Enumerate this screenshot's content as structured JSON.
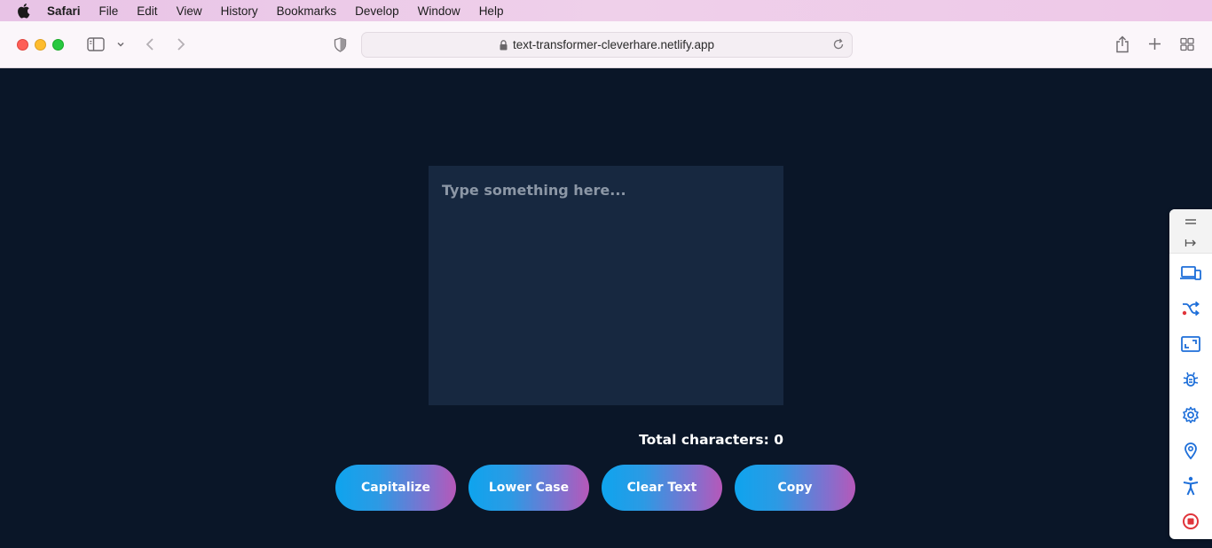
{
  "menubar": {
    "items": [
      "Safari",
      "File",
      "Edit",
      "View",
      "History",
      "Bookmarks",
      "Develop",
      "Window",
      "Help"
    ]
  },
  "browser": {
    "url": "text-transformer-cleverhare.netlify.app"
  },
  "app": {
    "textarea_placeholder": "Type something here...",
    "textarea_value": "",
    "count_text": "Total characters: 0",
    "buttons": [
      "Capitalize",
      "Lower Case",
      "Clear Text",
      "Copy"
    ]
  },
  "side_panel": {
    "icons": [
      "drag-handle-icon",
      "collapse-arrow-icon",
      "responsive-devices-icon",
      "shuffle-icon",
      "screenshot-icon",
      "bug-icon",
      "settings-gear-icon",
      "location-pin-icon",
      "accessibility-icon",
      "stop-record-icon"
    ]
  },
  "colors": {
    "page_background": "#0a1628",
    "textarea_background": "#172840",
    "button_gradient_start": "#0ea4ee",
    "button_gradient_end": "#b658b9",
    "menubar_background": "#e8c3e6",
    "side_icon_blue": "#1e6fd9",
    "side_icon_red": "#e0343a"
  }
}
